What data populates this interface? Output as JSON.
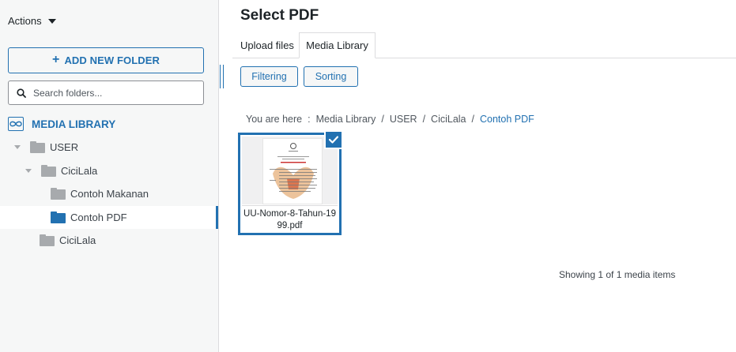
{
  "sidebar": {
    "actions_label": "Actions",
    "add_folder_label": "ADD NEW FOLDER",
    "search_placeholder": "Search folders...",
    "library_root_label": "MEDIA LIBRARY",
    "tree": [
      {
        "label": "USER",
        "expanded": true,
        "active": false
      },
      {
        "label": "CiciLala",
        "expanded": true,
        "active": false
      },
      {
        "label": "Contoh Makanan",
        "active": false
      },
      {
        "label": "Contoh PDF",
        "active": true
      },
      {
        "label": "CiciLala",
        "active": false
      }
    ]
  },
  "main": {
    "title": "Select PDF",
    "tabs": [
      {
        "label": "Upload files",
        "active": false
      },
      {
        "label": "Media Library",
        "active": true
      }
    ],
    "filter_label": "Filtering",
    "sort_label": "Sorting",
    "breadcrumb": {
      "prefix": "You are here",
      "items": [
        "Media Library",
        "USER",
        "CiciLala",
        "Contoh PDF"
      ]
    },
    "attachments": [
      {
        "filename": "UU-Nomor-8-Tahun-1999.pdf",
        "selected": true,
        "icon": "pdf-document-thumbnail"
      }
    ],
    "count_text": "Showing 1 of 1 media items"
  },
  "colors": {
    "accent": "#2271b1",
    "sidebar_bg": "#f6f7f7",
    "folder_grey": "#a7aaad"
  }
}
